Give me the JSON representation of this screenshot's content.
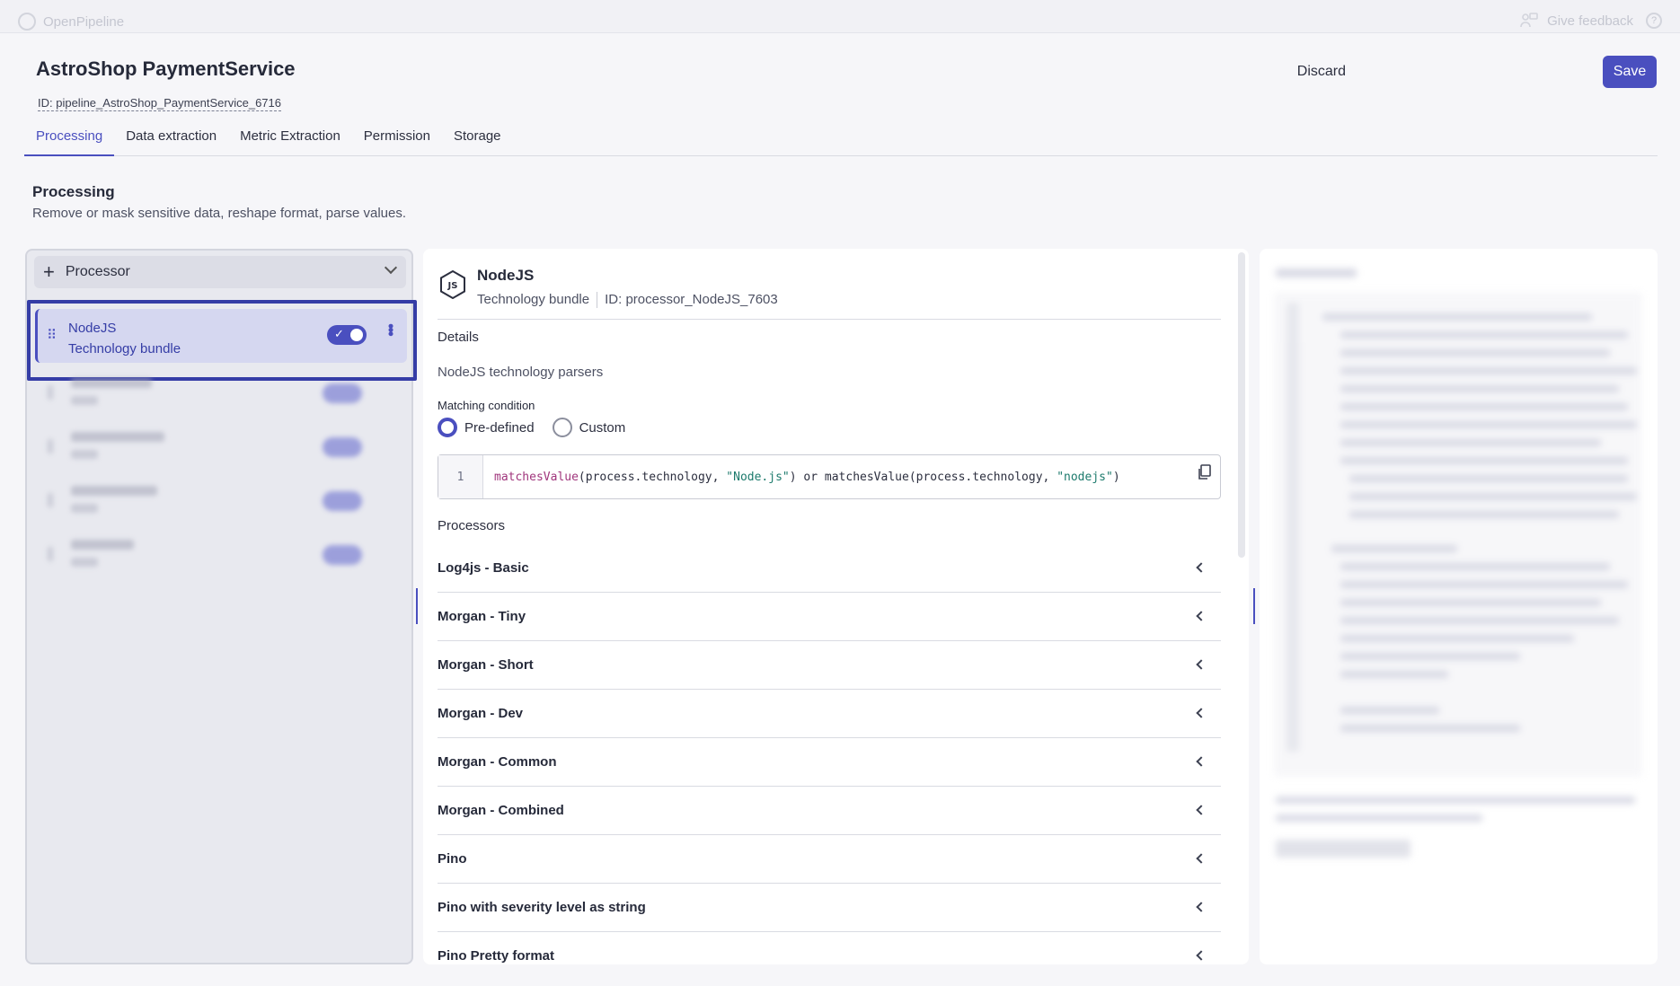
{
  "topbar": {
    "app_name": "OpenPipeline",
    "feedback": "Give feedback",
    "help": "?"
  },
  "header": {
    "title": "AstroShop PaymentService",
    "pipeline_id": "ID: pipeline_AstroShop_PaymentService_6716",
    "discard_label": "Discard",
    "save_label": "Save"
  },
  "tabs": [
    "Processing",
    "Data extraction",
    "Metric Extraction",
    "Permission",
    "Storage"
  ],
  "section": {
    "title": "Processing",
    "subtitle": "Remove or mask sensitive data, reshape format, parse values."
  },
  "left": {
    "add_label": "Processor",
    "selected": {
      "name": "NodeJS",
      "type": "Technology bundle",
      "enabled": true
    }
  },
  "detail": {
    "name": "NodeJS",
    "type": "Technology bundle",
    "processor_id": "ID: processor_NodeJS_7603",
    "details_label": "Details",
    "description": "NodeJS technology parsers",
    "matching_label": "Matching condition",
    "radio_predefined": "Pre-defined",
    "radio_custom": "Custom",
    "code_line": "1",
    "code": {
      "fn1": "matchesValue",
      "arg1": "(process.technology, ",
      "str1": "\"Node.js\"",
      "mid": ") or ",
      "fn2": "matchesValue",
      "arg2": "(process.technology, ",
      "str2": "\"nodejs\"",
      "end": ")"
    },
    "processors_label": "Processors",
    "processors": [
      "Log4js - Basic",
      "Morgan - Tiny",
      "Morgan - Short",
      "Morgan - Dev",
      "Morgan - Common",
      "Morgan - Combined",
      "Pino",
      "Pino with severity level as string",
      "Pino Pretty format"
    ]
  },
  "colors": {
    "accent": "#4a4fbf",
    "selection_border": "#353da6"
  }
}
